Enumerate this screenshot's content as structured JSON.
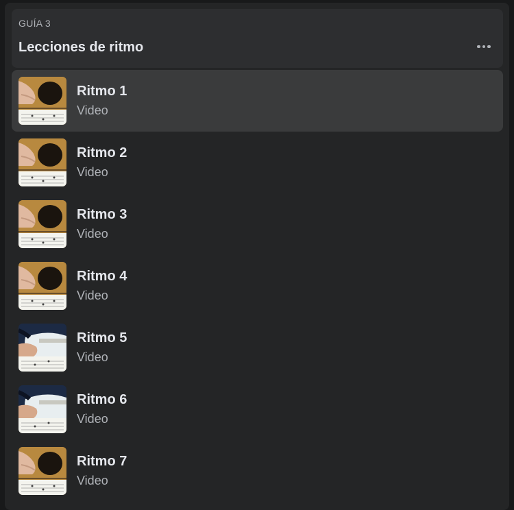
{
  "guide": {
    "label": "GUÍA 3",
    "title": "Lecciones de ritmo",
    "more_icon": "more-horizontal-icon"
  },
  "items": [
    {
      "title": "Ritmo 1",
      "type": "Video",
      "thumb": "acoustic"
    },
    {
      "title": "Ritmo 2",
      "type": "Video",
      "thumb": "acoustic"
    },
    {
      "title": "Ritmo 3",
      "type": "Video",
      "thumb": "acoustic"
    },
    {
      "title": "Ritmo 4",
      "type": "Video",
      "thumb": "acoustic"
    },
    {
      "title": "Ritmo 5",
      "type": "Video",
      "thumb": "electric"
    },
    {
      "title": "Ritmo 6",
      "type": "Video",
      "thumb": "electric"
    },
    {
      "title": "Ritmo 7",
      "type": "Video",
      "thumb": "acoustic"
    }
  ],
  "colors": {
    "background": "#18191a",
    "panel": "#242526",
    "header": "#2d2e30",
    "active_item": "#3a3b3c",
    "primary_text": "#e4e6eb",
    "secondary_text": "#b0b3b8"
  }
}
